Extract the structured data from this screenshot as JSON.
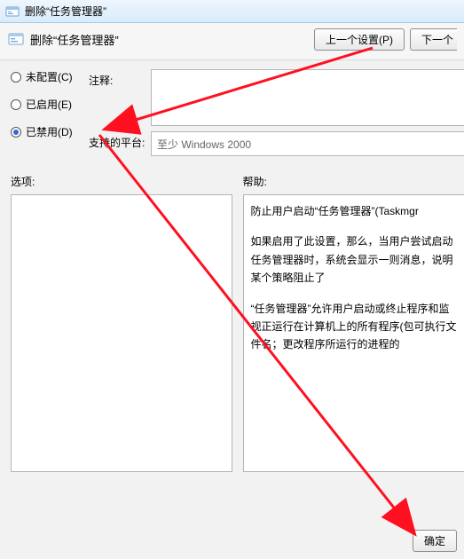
{
  "window": {
    "title": "删除“任务管理器”"
  },
  "header": {
    "heading": "删除“任务管理器”",
    "prev_button": "上一个设置(P)",
    "next_button": "下一个"
  },
  "radios": {
    "not_configured": "未配置(C)",
    "enabled": "已启用(E)",
    "disabled": "已禁用(D)",
    "selected": "disabled"
  },
  "fields": {
    "comment_label": "注释:",
    "comment_value": "",
    "platform_label": "支持的平台:",
    "platform_value": "至少 Windows 2000"
  },
  "lower": {
    "options_label": "选项:",
    "help_label": "帮助:",
    "help_paragraphs": [
      "防止用户启动“任务管理器”(Taskmgr",
      "如果启用了此设置，那么，当用户尝试启动任务管理器时，系统会显示一则消息，说明某个策略阻止了",
      "“任务管理器”允许用户启动或终止程序和监视正运行在计算机上的所有程序(包可执行文件名；更改程序所运行的进程的"
    ]
  },
  "footer": {
    "ok": "确定"
  }
}
